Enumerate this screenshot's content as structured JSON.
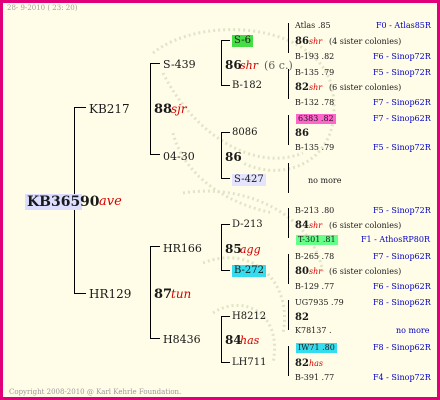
{
  "header": {
    "date": "28-  9-2010  ( 23: 20)"
  },
  "footer": {
    "copyright": "Copyright 2008-2010 @ Karl Kehrle Foundation."
  },
  "root": {
    "name": "KB365",
    "num": "90",
    "tag": "ave"
  },
  "gen1": [
    {
      "name": "KB217",
      "num": "88",
      "tag": "sjr"
    },
    {
      "name": "HR129",
      "num": "87",
      "tag": "tun"
    }
  ],
  "gen2": [
    {
      "name": "S-439",
      "num": "86",
      "tag": "shr",
      "note": "(6 c.)"
    },
    {
      "name": "04-30",
      "num": "86"
    },
    {
      "name": "HR166",
      "num": "85",
      "tag": "agg"
    },
    {
      "name": "H8436",
      "num": "84",
      "tag": "has"
    }
  ],
  "gen3": [
    {
      "name": "S-6",
      "num": "86",
      "tag": "shr",
      "note": "(6 c.)"
    },
    {
      "name": "B-182",
      "num": "82",
      "tag": "shr"
    },
    {
      "name": "8086",
      "num": "86"
    },
    {
      "name": "S-427"
    },
    {
      "name": "D-213",
      "num": "84",
      "tag": "shr"
    },
    {
      "name": "B-272",
      "num": "80",
      "tag": "shr"
    },
    {
      "name": "H8212",
      "num": "82"
    },
    {
      "name": "LH711",
      "num": "82",
      "tag": "has"
    }
  ],
  "gen4": [
    {
      "name": "Atlas .85",
      "code": "F0 - Atlas85R"
    },
    {
      "name": "B-193 .82",
      "code": "F6 - Sinop72R"
    },
    {
      "name": "B-135 .79",
      "code": "F5 - Sinop72R"
    },
    {
      "name": "B-132 .78",
      "code": "F7 - Sinop62R"
    },
    {
      "name": "6383 .82",
      "code": "F7 - Sinop62R"
    },
    {
      "name": "B-135 .79",
      "code": "F5 - Sinop72R"
    },
    {
      "name": "no more"
    },
    {
      "name": "B-213 .80",
      "code": "F5 - Sinop72R"
    },
    {
      "name": "T-301 .81",
      "code": "F1 - AthosRP80R"
    },
    {
      "name": "B-265 .78",
      "code": "F7 - Sinop62R"
    },
    {
      "name": "B-129 .77",
      "code": "F6 - Sinop62R"
    },
    {
      "name": "UG7935 .79",
      "code": "F8 - Sinop62R"
    },
    {
      "name": "K78137 .",
      "code": "no more"
    },
    {
      "name": "IW71 .80",
      "code": "F8 - Sinop62R"
    },
    {
      "name": "B-391 .77",
      "code": "F4 - Sinop72R"
    }
  ],
  "sister_note": "(4 sister colonies)",
  "sister_note6": "(6 sister colonies)"
}
